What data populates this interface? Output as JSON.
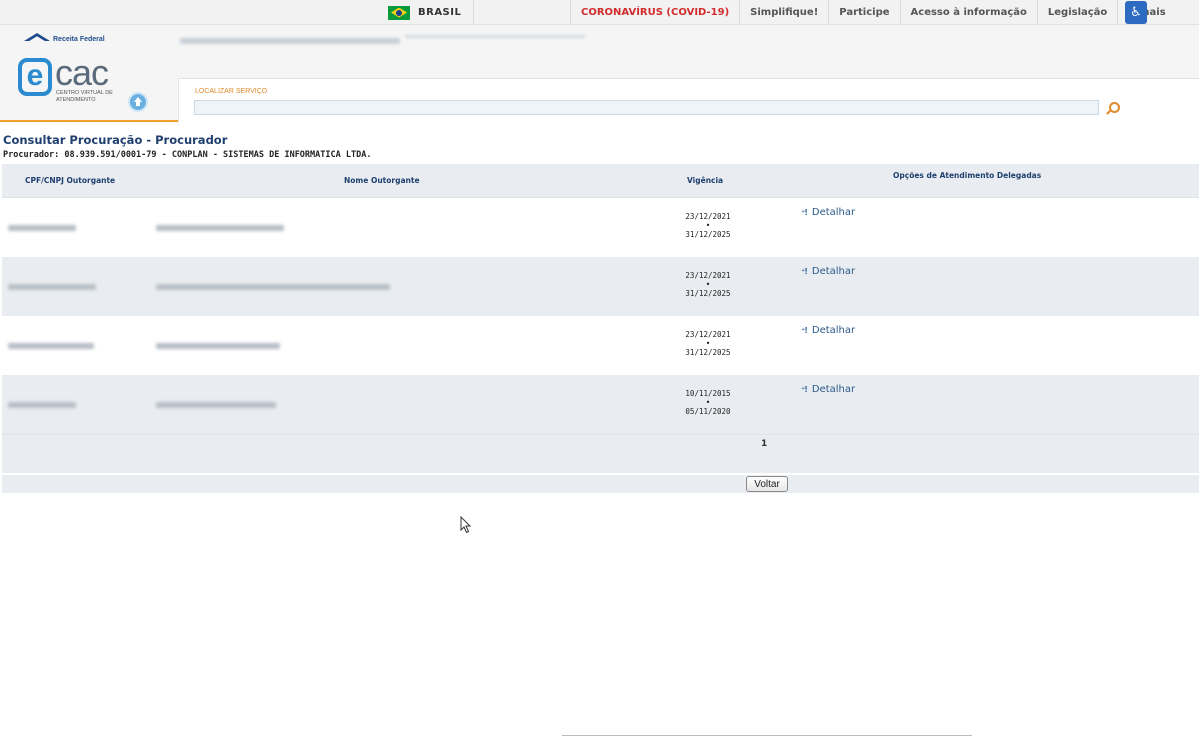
{
  "gov_bar": {
    "country": "BRASIL",
    "links": [
      {
        "label": "CORONAVÍRUS (COVID-19)",
        "highlight": true
      },
      {
        "label": "Simplifique!"
      },
      {
        "label": "Participe"
      },
      {
        "label": "Acesso à informação"
      },
      {
        "label": "Legislação"
      },
      {
        "label": "Canais"
      }
    ]
  },
  "header": {
    "logo_brand": "Receita Federal",
    "ecac_logo": "cac",
    "ecac_subtitle": "CENTRO VIRTUAL DE ATENDIMENTO",
    "search_label": "LOCALIZAR SERVIÇO",
    "search_value": ""
  },
  "page": {
    "title": "Consultar Procuração - Procurador",
    "procurador_line": "Procurador: 08.939.591/0001-79 - CONPLAN - SISTEMAS DE INFORMATICA LTDA."
  },
  "table": {
    "headers": {
      "cpf_cnpj": "CPF/CNPJ Outorgante",
      "nome": "Nome Outorgante",
      "vigencia": "Vigência",
      "opcoes": "Opções de Atendimento Delegadas"
    },
    "rows": [
      {
        "vig_start": "23/12/2021",
        "vig_end": "31/12/2025",
        "action": "Detalhar"
      },
      {
        "vig_start": "23/12/2021",
        "vig_end": "31/12/2025",
        "action": "Detalhar"
      },
      {
        "vig_start": "23/12/2021",
        "vig_end": "31/12/2025",
        "action": "Detalhar"
      },
      {
        "vig_start": "10/11/2015",
        "vig_end": "05/11/2020",
        "action": "Detalhar"
      }
    ],
    "page_number": "1"
  },
  "buttons": {
    "voltar": "Voltar"
  },
  "colors": {
    "accent_orange": "#f0a030",
    "title_blue": "#1f3f6f",
    "covid_red": "#d22c2c",
    "row_alt": "#e9edf1"
  }
}
